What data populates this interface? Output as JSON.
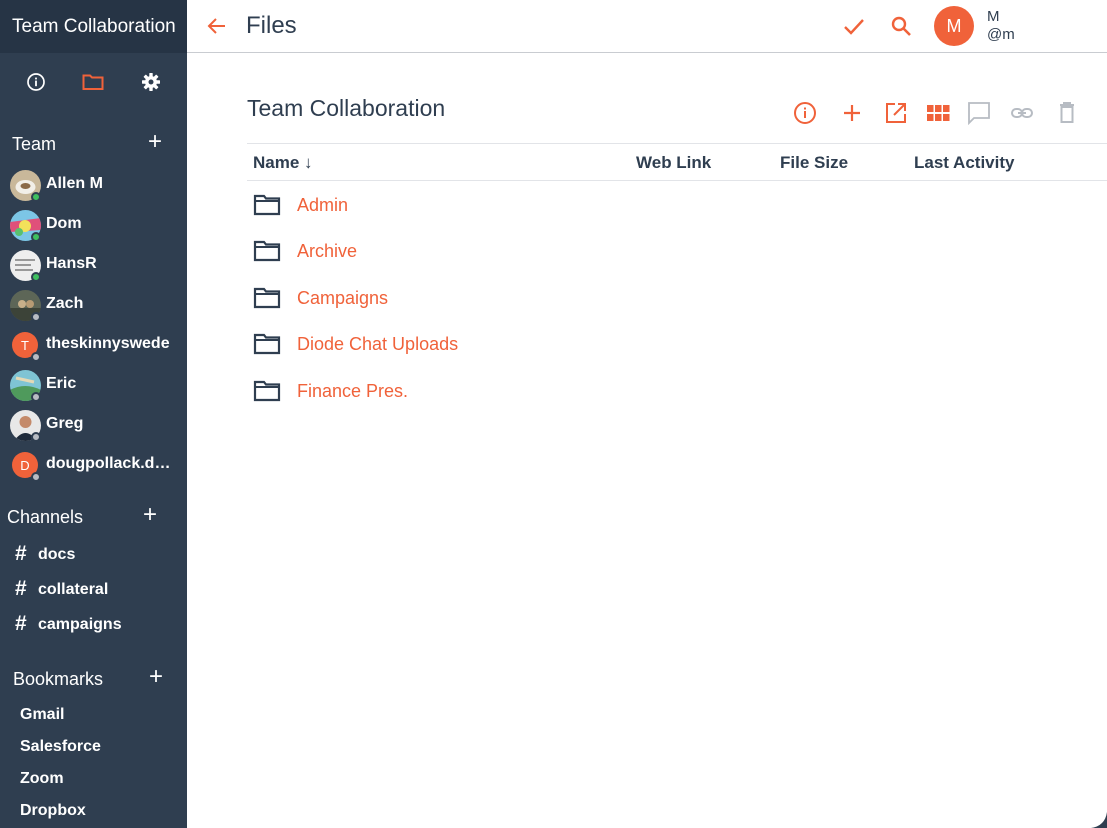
{
  "sidebar": {
    "title": "Team Collaboration",
    "icons": [
      "info-icon",
      "folder-icon",
      "gear-icon"
    ],
    "team": {
      "title": "Team",
      "members": [
        {
          "name": "Allen M",
          "avatar": "photo",
          "status_color": "#3fbf5f"
        },
        {
          "name": "Dom",
          "avatar": "photo",
          "status_color": "#3fbf5f"
        },
        {
          "name": "HansR",
          "avatar": "photo",
          "status_color": "#3fbf5f"
        },
        {
          "name": "Zach",
          "avatar": "photo",
          "status_color": "#b8bcc2"
        },
        {
          "name": "theskinnyswede",
          "avatar": "T",
          "status_color": "#b8bcc2"
        },
        {
          "name": "Eric",
          "avatar": "photo",
          "status_color": "#b8bcc2"
        },
        {
          "name": "Greg",
          "avatar": "photo",
          "status_color": "#b8bcc2"
        },
        {
          "name": "dougpollack.dio...",
          "avatar": "D",
          "status_color": "#b8bcc2"
        }
      ]
    },
    "channels": {
      "title": "Channels",
      "items": [
        "docs",
        "collateral",
        "campaigns"
      ],
      "hash": "#"
    },
    "bookmarks": {
      "title": "Bookmarks",
      "items": [
        "Gmail",
        "Salesforce",
        "Zoom",
        "Dropbox"
      ]
    }
  },
  "header": {
    "title": "Files",
    "user_initial": "M",
    "user_name": "M",
    "user_handle": "@m"
  },
  "main": {
    "title": "Team Collaboration",
    "toolbar": [
      "info-icon",
      "add-icon",
      "open-external-icon",
      "grid-view-icon",
      "comment-icon",
      "link-icon",
      "trash-icon"
    ],
    "columns": {
      "name": "Name",
      "sort_arrow": "↓",
      "web_link": "Web Link",
      "file_size": "File Size",
      "last_activity": "Last Activity"
    },
    "rows": [
      {
        "name": "Admin"
      },
      {
        "name": "Archive"
      },
      {
        "name": "Campaigns"
      },
      {
        "name": "Diode Chat Uploads"
      },
      {
        "name": "Finance Pres."
      }
    ]
  },
  "colors": {
    "accent": "#f0623a",
    "sidebar": "#2f3e50",
    "sidebar_title": "#263445",
    "text": "#2f3e50",
    "muted_icon": "#b7bcc3"
  }
}
